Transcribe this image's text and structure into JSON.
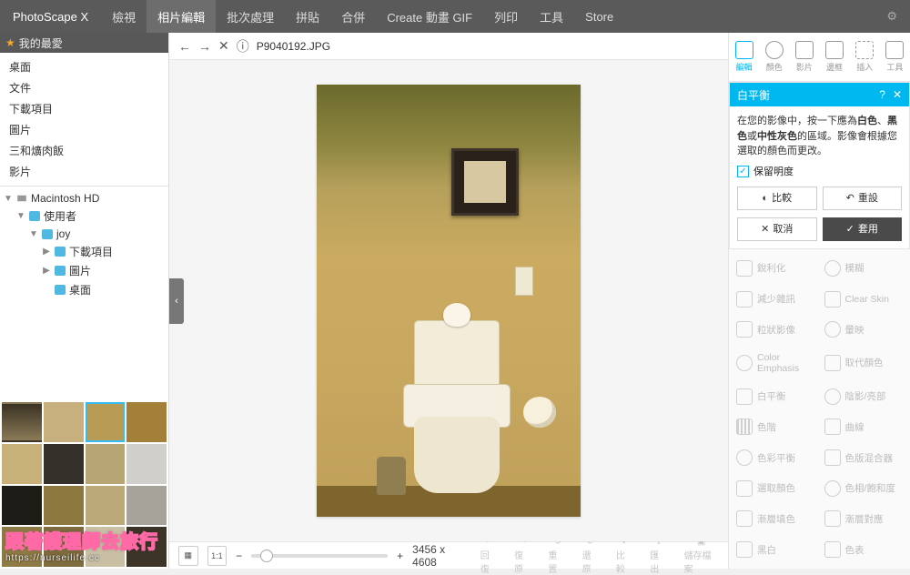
{
  "app": {
    "name": "PhotoScape X"
  },
  "menu": [
    "檢視",
    "相片編輯",
    "批次處理",
    "拼貼",
    "合併",
    "Create 動畫 GIF",
    "列印",
    "工具",
    "Store"
  ],
  "menu_active": 1,
  "sidebar": {
    "fav_label": "我的最愛",
    "quick": [
      "桌面",
      "文件",
      "下載項目",
      "圖片",
      "三和爌肉飯",
      "影片"
    ],
    "tree": {
      "root": "Macintosh HD",
      "n1": "使用者",
      "n2": "joy",
      "children": [
        "下載項目",
        "圖片",
        "桌面"
      ]
    }
  },
  "path": {
    "filename": "P9040192.JPG"
  },
  "status": {
    "dims": "3456 x 4608",
    "zoom_label": "1:1"
  },
  "rtool": {
    "tabs": [
      "編輯",
      "顏色",
      "影片",
      "邊框",
      "插入",
      "工具"
    ],
    "active": 0,
    "panel": {
      "title": "白平衡",
      "desc_1": "在您的影像中，按一下應為",
      "desc_bold1": "白色",
      "desc_sep": "、",
      "desc_bold2": "黑色",
      "desc_2": "或",
      "desc_bold3": "中性灰色",
      "desc_3": "的區域。影像會根據您選取的顏色而更改。",
      "preserve": "保留明度",
      "compare": "比較",
      "reset": "重設",
      "cancel": "取消",
      "apply": "套用"
    },
    "adjust": [
      "銳利化",
      "模糊",
      "減少雜訊",
      "Clear Skin",
      "粒狀影像",
      "暈映",
      "Color Emphasis",
      "取代顏色",
      "白平衡",
      "陰影/亮部",
      "色階",
      "曲線",
      "色彩平衡",
      "色版混合器",
      "選取顏色",
      "色相/飽和度",
      "漸層填色",
      "漸層對應",
      "黑白",
      "色表"
    ]
  },
  "bottom_actions": [
    "回復",
    "復原",
    "重置",
    "還原",
    "比較",
    "匯出",
    "儲存檔案"
  ],
  "watermark": {
    "text": "跟著護理師去旅行",
    "url": "https://nurseilife.cc"
  }
}
